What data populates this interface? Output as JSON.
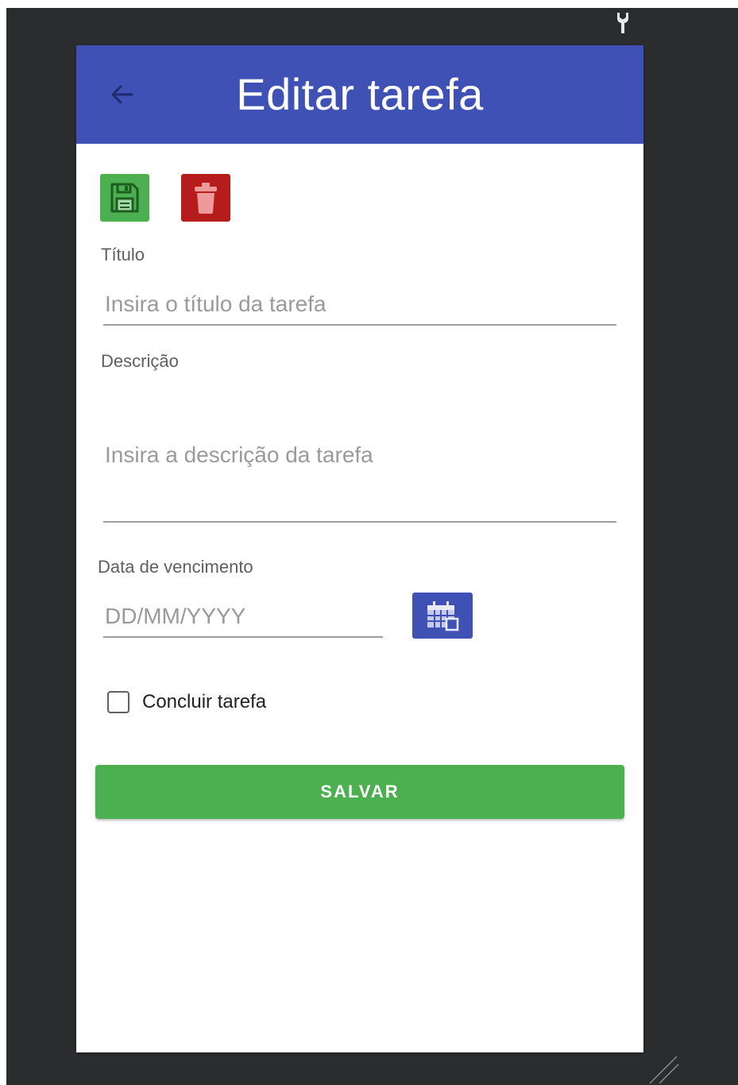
{
  "header": {
    "title": "Editar tarefa",
    "back_icon": "arrow-left-icon"
  },
  "toolbar": {
    "save_icon": "floppy-disk-icon",
    "delete_icon": "trash-can-icon"
  },
  "form": {
    "title_label": "Título",
    "title_placeholder": "Insira o título da tarefa",
    "title_value": "",
    "description_label": "Descrição",
    "description_placeholder": "Insira a descrição da tarefa",
    "description_value": "",
    "due_date_label": "Data de vencimento",
    "due_date_placeholder": "DD/MM/YYYY",
    "due_date_value": "",
    "date_picker_icon": "calendar-icon",
    "complete_checkbox_label": "Concluir tarefa",
    "complete_checked": false,
    "submit_label": "SALVAR"
  },
  "colors": {
    "app_bar": "#3f51b5",
    "save": "#4caf50",
    "delete": "#b71c1c",
    "editor_background": "#2b2c2e"
  },
  "editor": {
    "wrench_icon": "wrench-icon",
    "resize_icon": "resize-grip-icon"
  }
}
